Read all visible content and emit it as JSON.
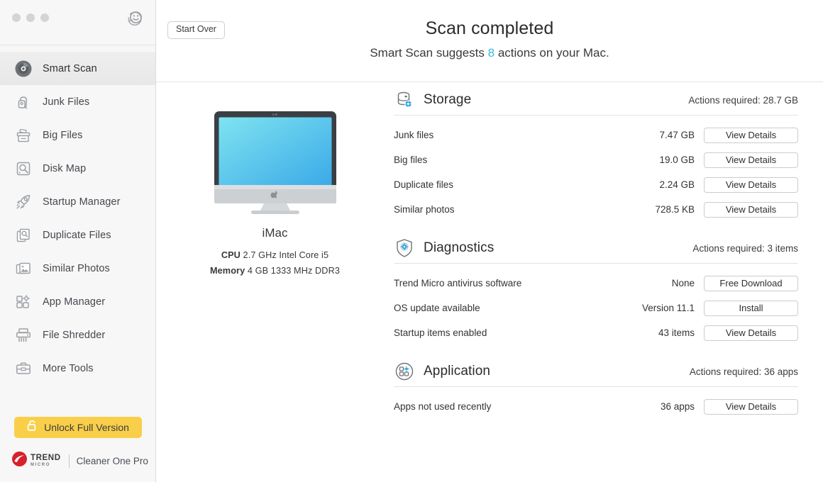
{
  "window": {
    "traffic_lights": [
      "close",
      "minimize",
      "maximize"
    ],
    "feedback_icon": "smiley-feedback-icon"
  },
  "sidebar": {
    "items": [
      {
        "label": "Smart Scan",
        "icon": "smart-scan-icon",
        "active": true
      },
      {
        "label": "Junk Files",
        "icon": "junk-files-icon",
        "active": false
      },
      {
        "label": "Big Files",
        "icon": "big-files-icon",
        "active": false
      },
      {
        "label": "Disk Map",
        "icon": "disk-map-icon",
        "active": false
      },
      {
        "label": "Startup Manager",
        "icon": "startup-manager-icon",
        "active": false
      },
      {
        "label": "Duplicate Files",
        "icon": "duplicate-files-icon",
        "active": false
      },
      {
        "label": "Similar Photos",
        "icon": "similar-photos-icon",
        "active": false
      },
      {
        "label": "App Manager",
        "icon": "app-manager-icon",
        "active": false
      },
      {
        "label": "File Shredder",
        "icon": "file-shredder-icon",
        "active": false
      },
      {
        "label": "More Tools",
        "icon": "more-tools-icon",
        "active": false
      }
    ],
    "unlock_button": {
      "label": "Unlock Full Version",
      "icon": "unlock-padlock-icon",
      "color": "#f9cf4a"
    },
    "brand": {
      "vendor_line1": "TREND",
      "vendor_line2": "MICRO",
      "product": "Cleaner One Pro",
      "logo_color": "#d6222b"
    }
  },
  "header": {
    "start_over_label": "Start Over",
    "title": "Scan completed",
    "subtitle_prefix": "Smart Scan suggests ",
    "subtitle_count": "8",
    "subtitle_suffix": " actions on your Mac.",
    "accent_color": "#35b9e6"
  },
  "device": {
    "name": "iMac",
    "cpu_label": "CPU",
    "cpu_value": " 2.7 GHz Intel Core i5",
    "memory_label": "Memory",
    "memory_value": " 4 GB 1333 MHz DDR3",
    "screen_gradient_from": "#7fe3f0",
    "screen_gradient_to": "#3aa9e8"
  },
  "sections": [
    {
      "title": "Storage",
      "icon": "storage-database-icon",
      "actions_required": "Actions required: 28.7 GB",
      "rows": [
        {
          "name": "Junk files",
          "value": "7.47 GB",
          "button": "View Details"
        },
        {
          "name": "Big files",
          "value": "19.0 GB",
          "button": "View Details"
        },
        {
          "name": "Duplicate files",
          "value": "2.24 GB",
          "button": "View Details"
        },
        {
          "name": "Similar photos",
          "value": "728.5 KB",
          "button": "View Details"
        }
      ]
    },
    {
      "title": "Diagnostics",
      "icon": "diagnostics-shield-icon",
      "actions_required": "Actions required: 3 items",
      "rows": [
        {
          "name": "Trend Micro antivirus software",
          "value": "None",
          "button": "Free Download"
        },
        {
          "name": "OS update available",
          "value": "Version 11.1",
          "button": "Install"
        },
        {
          "name": "Startup items enabled",
          "value": "43 items",
          "button": "View Details"
        }
      ]
    },
    {
      "title": "Application",
      "icon": "application-grid-icon",
      "actions_required": "Actions required: 36 apps",
      "rows": [
        {
          "name": "Apps not used recently",
          "value": "36 apps",
          "button": "View Details"
        }
      ]
    }
  ]
}
